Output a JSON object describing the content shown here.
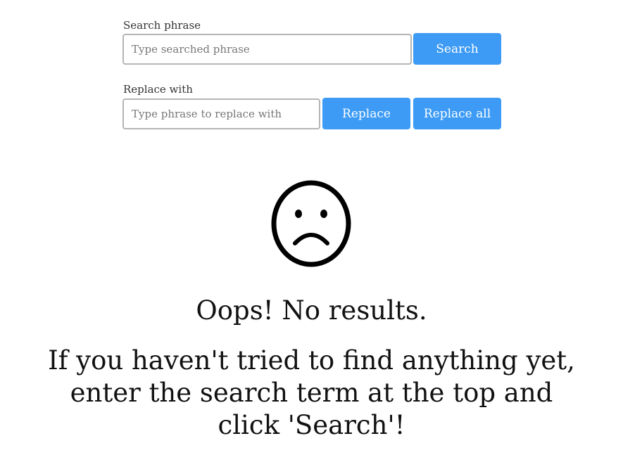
{
  "search": {
    "label": "Search phrase",
    "placeholder": "Type searched phrase",
    "value": "",
    "button_label": "Search"
  },
  "replace": {
    "label": "Replace with",
    "placeholder": "Type phrase to replace with",
    "value": "",
    "replace_button_label": "Replace",
    "replace_all_button_label": "Replace all"
  },
  "empty_state": {
    "icon": "sad-face-icon",
    "title": "Oops! No results.",
    "message": "If you haven't tried to find anything yet, enter the search term at the top and click 'Search'!"
  },
  "colors": {
    "accent": "#3d9bf5"
  }
}
